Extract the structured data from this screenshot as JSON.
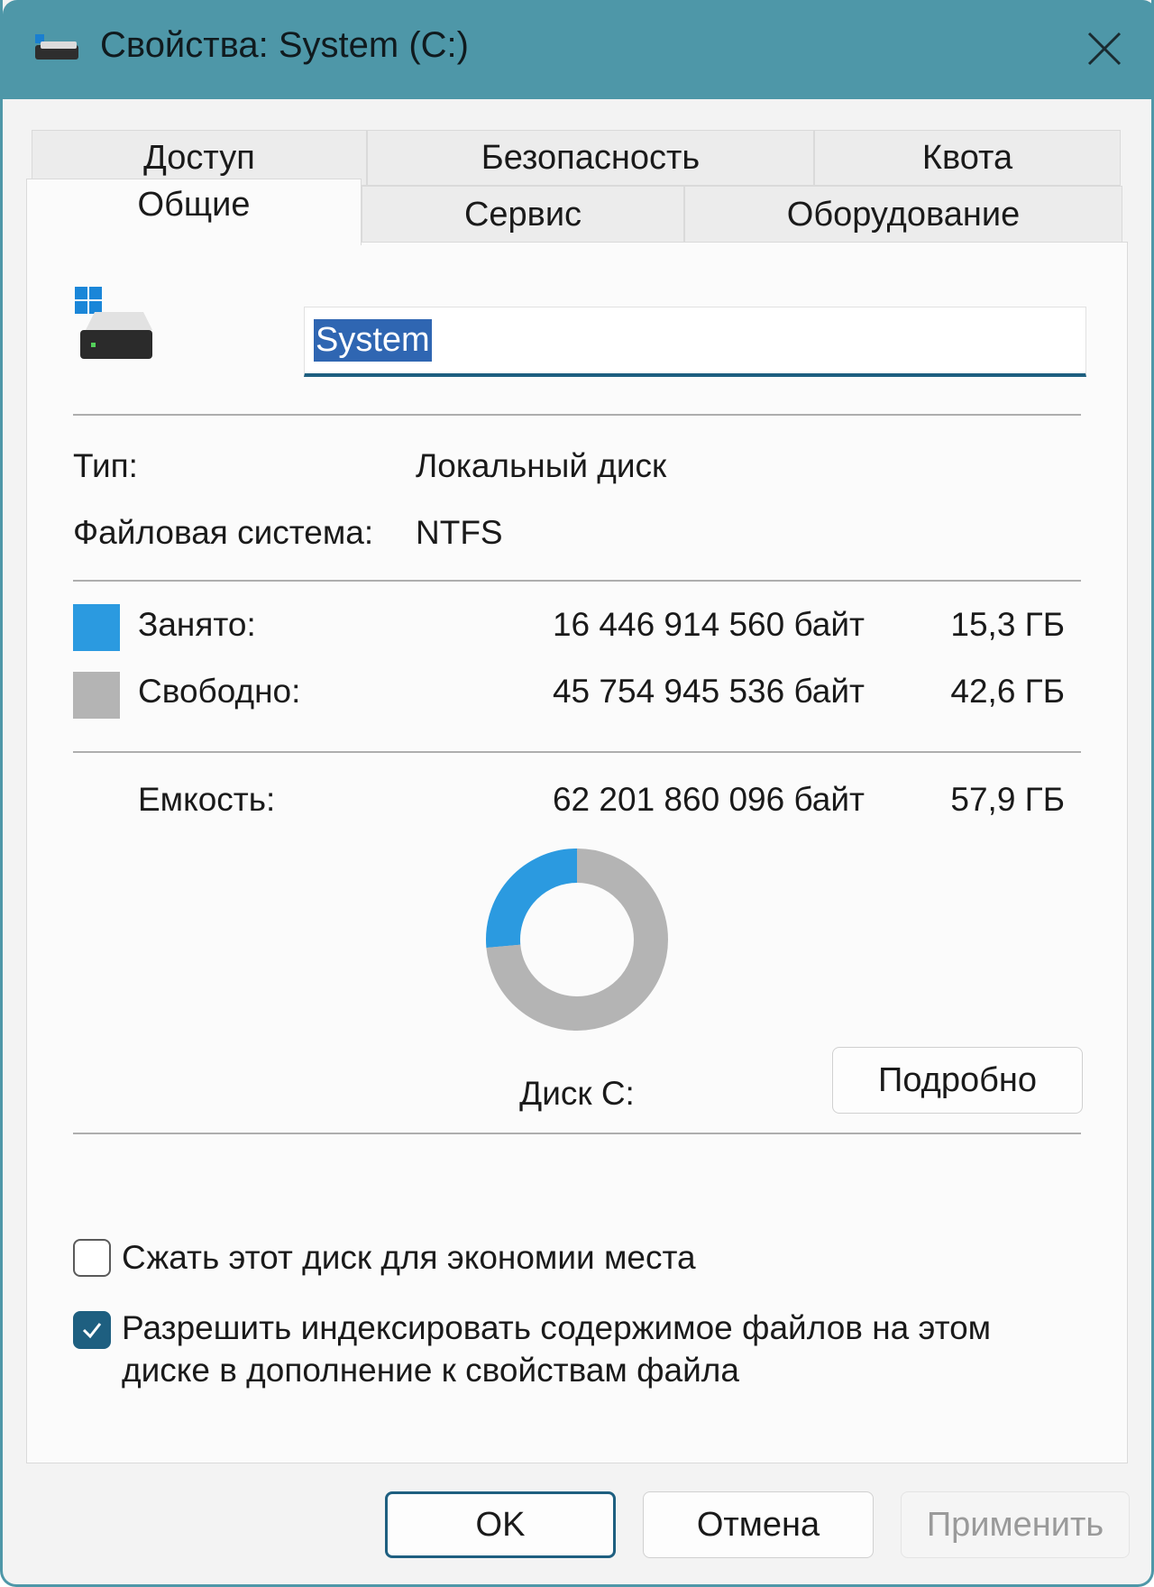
{
  "window": {
    "title": "Свойства: System (C:)"
  },
  "tabs": {
    "row1": [
      {
        "label": "Доступ"
      },
      {
        "label": "Безопасность"
      },
      {
        "label": "Квота"
      }
    ],
    "row2": [
      {
        "label": "Общие",
        "active": true
      },
      {
        "label": "Сервис"
      },
      {
        "label": "Оборудование"
      }
    ]
  },
  "general": {
    "volume_name": "System",
    "type_label": "Тип:",
    "type_value": "Локальный диск",
    "fs_label": "Файловая система:",
    "fs_value": "NTFS",
    "used": {
      "label": "Занято:",
      "bytes": "16 446 914 560 байт",
      "size": "15,3 ГБ",
      "color": "#2b9ae0"
    },
    "free": {
      "label": "Свободно:",
      "bytes": "45 754 945 536 байт",
      "size": "42,6 ГБ",
      "color": "#b4b4b4"
    },
    "capacity": {
      "label": "Емкость:",
      "bytes": "62 201 860 096 байт",
      "size": "57,9 ГБ"
    },
    "disk_label": "Диск C:",
    "details_button": "Подробно",
    "compress_label": "Сжать этот диск для экономии места",
    "compress_checked": false,
    "index_label_line1": "Разрешить индексировать содержимое файлов на этом",
    "index_label_line2": "диске в дополнение к свойствам файла",
    "index_checked": true
  },
  "chart_data": {
    "type": "pie",
    "categories": [
      "Занято:",
      "Свободно:"
    ],
    "values": [
      16446914560,
      45754945536
    ],
    "colors": [
      "#2b9ae0",
      "#b4b4b4"
    ],
    "title": "Диск C:"
  },
  "footer": {
    "ok": "OK",
    "cancel": "Отмена",
    "apply": "Применить"
  }
}
